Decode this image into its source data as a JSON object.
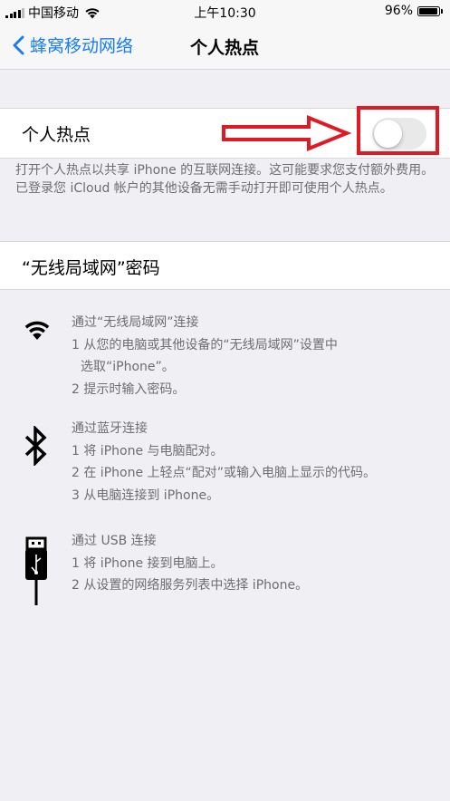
{
  "status_bar": {
    "carrier": "中国移动",
    "time": "上午10:30",
    "battery": "96%",
    "battery_level": 0.96
  },
  "nav": {
    "back_label": "蜂窝移动网络",
    "title": "个人热点"
  },
  "hotspot": {
    "label": "个人热点",
    "enabled": false,
    "footer": "打开个人热点以共享 iPhone 的互联网连接。这可能要求您支付额外费用。已登录您 iCloud 帐户的其他设备无需手动打开即可使用个人热点。"
  },
  "wifi_password": {
    "label": "“无线局域网”密码"
  },
  "instructions": {
    "wifi": {
      "title": "通过“无线局域网”连接",
      "step1": "1 从您的电脑或其他设备的“无线局域网”设置中",
      "step1b": "选取“iPhone”。",
      "step2": "2 提示时输入密码。"
    },
    "bluetooth": {
      "title": "通过蓝牙连接",
      "step1": "1 将 iPhone 与电脑配对。",
      "step2": "2 在 iPhone 上轻点“配对”或输入电脑上显示的代码。",
      "step3": "3 从电脑连接到 iPhone。"
    },
    "usb": {
      "title": "通过 USB 连接",
      "step1": "1 将 iPhone 接到电脑上。",
      "step2": "2 从设置的网络服务列表中选择 iPhone。"
    }
  },
  "icons": {
    "wifi": "wifi-icon",
    "bluetooth": "bluetooth-icon",
    "usb": "usb-cable-icon",
    "back": "chevron-left-icon"
  },
  "colors": {
    "accent": "#1a7cf5",
    "annotation_red": "#e01a24",
    "toggle_off": "#e9e9ea",
    "footer_gray": "#6d6d72"
  }
}
